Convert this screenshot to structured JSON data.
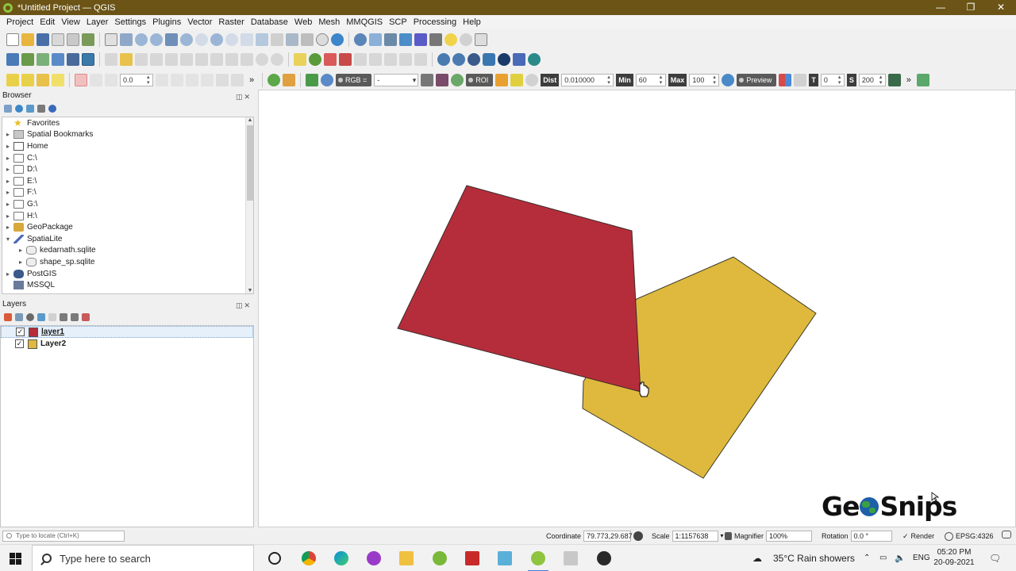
{
  "window": {
    "title": "*Untitled Project — QGIS",
    "min": "—",
    "max": "❐",
    "close": "✕"
  },
  "menu": [
    "Project",
    "Edit",
    "View",
    "Layer",
    "Settings",
    "Plugins",
    "Vector",
    "Raster",
    "Database",
    "Web",
    "Mesh",
    "MMQGIS",
    "SCP",
    "Processing",
    "Help"
  ],
  "toolbar3": {
    "opacity_value": "0.0",
    "rgb_label": "RGB =",
    "rgb_value": "-",
    "roi_label": "ROI",
    "dist_label": "Dist",
    "dist_value": "0.010000",
    "min_label": "Min",
    "min_value": "60",
    "max_label": "Max",
    "max_value": "100",
    "preview_label": "Preview",
    "t_label": "T",
    "t_value": "0",
    "s_label": "S",
    "s_value": "200",
    "more": "»"
  },
  "browser": {
    "title": "Browser",
    "items": [
      {
        "label": "Favorites",
        "arrow": "",
        "icon": "star"
      },
      {
        "label": "Spatial Bookmarks",
        "arrow": "▸",
        "icon": "bookmark"
      },
      {
        "label": "Home",
        "arrow": "▸",
        "icon": "home"
      },
      {
        "label": "C:\\",
        "arrow": "▸",
        "icon": "folder"
      },
      {
        "label": "D:\\",
        "arrow": "▸",
        "icon": "folder"
      },
      {
        "label": "E:\\",
        "arrow": "▸",
        "icon": "folder"
      },
      {
        "label": "F:\\",
        "arrow": "▸",
        "icon": "folder"
      },
      {
        "label": "G:\\",
        "arrow": "▸",
        "icon": "folder"
      },
      {
        "label": "H:\\",
        "arrow": "▸",
        "icon": "folder"
      },
      {
        "label": "GeoPackage",
        "arrow": "▸",
        "icon": "geopackage"
      },
      {
        "label": "SpatiaLite",
        "arrow": "▾",
        "icon": "spatialite"
      },
      {
        "label": "kedarnath.sqlite",
        "arrow": "▸",
        "icon": "database",
        "indent": 1
      },
      {
        "label": "shape_sp.sqlite",
        "arrow": "▸",
        "icon": "database",
        "indent": 1
      },
      {
        "label": "PostGIS",
        "arrow": "▸",
        "icon": "postgis"
      },
      {
        "label": "MSSQL",
        "arrow": "",
        "icon": "mssql"
      }
    ]
  },
  "layers": {
    "title": "Layers",
    "items": [
      {
        "name": "layer1",
        "checked": "✓",
        "color": "#b52d3a",
        "selected": true
      },
      {
        "name": "Layer2",
        "checked": "✓",
        "color": "#dfb93d",
        "selected": false
      }
    ]
  },
  "map": {
    "layer1_fill": "#b52d3a",
    "layer2_fill": "#dfb93d",
    "watermark_left": "Ge",
    "watermark_right": "Snips"
  },
  "statusbar": {
    "locate_placeholder": "Type to locate (Ctrl+K)",
    "coordinate_label": "Coordinate",
    "coordinate_value": "79.773,29.687",
    "scale_label": "Scale",
    "scale_value": "1:1157638",
    "magnifier_label": "Magnifier",
    "magnifier_value": "100%",
    "rotation_label": "Rotation",
    "rotation_value": "0.0 °",
    "render_label": "Render",
    "render_checked": "✓",
    "crs": "EPSG:4326"
  },
  "taskbar": {
    "search_placeholder": "Type here to search",
    "weather": "35°C  Rain showers",
    "language": "ENG",
    "time": "05:20 PM",
    "date": "20-09-2021"
  }
}
